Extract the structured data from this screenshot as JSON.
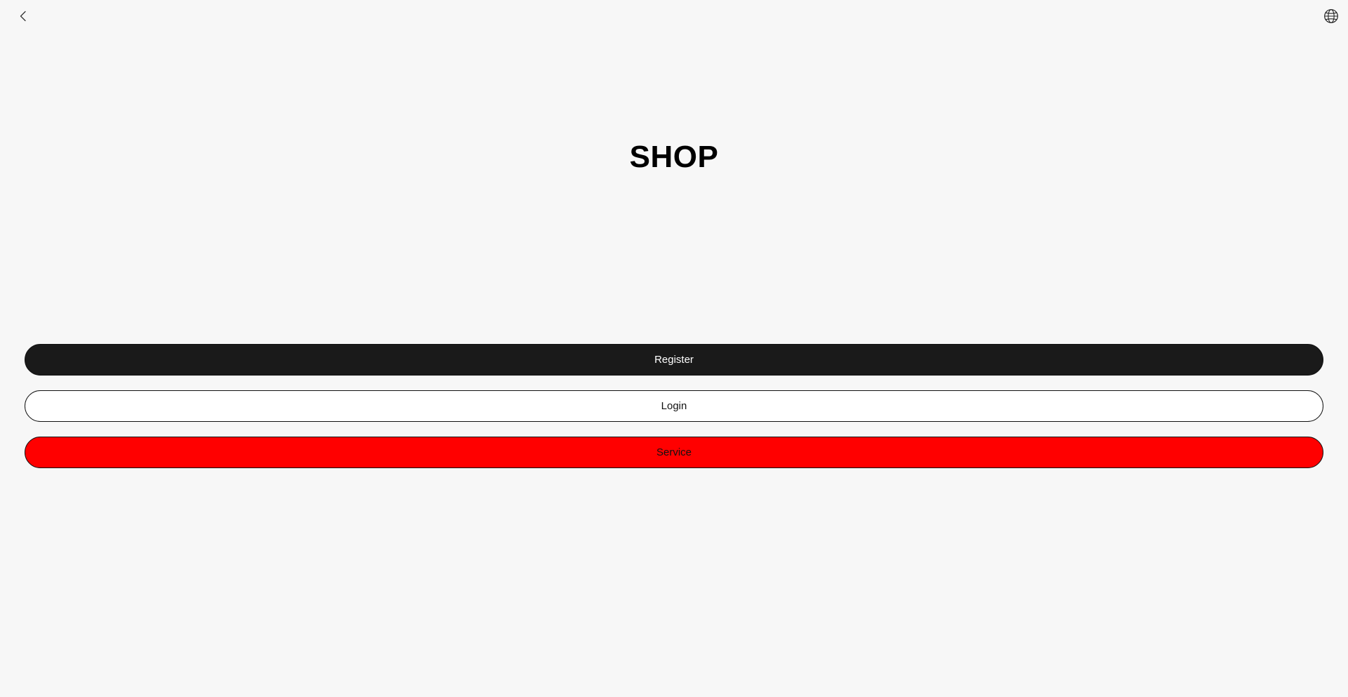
{
  "header": {
    "back_icon": "chevron-left-icon",
    "language_icon": "globe-icon"
  },
  "brand": {
    "title": "SHOP"
  },
  "actions": {
    "register_label": "Register",
    "login_label": "Login",
    "service_label": "Service"
  },
  "colors": {
    "background": "#f7f7f7",
    "register_bg": "#1a1a1a",
    "login_bg": "#ffffff",
    "service_bg": "#ff0000"
  }
}
